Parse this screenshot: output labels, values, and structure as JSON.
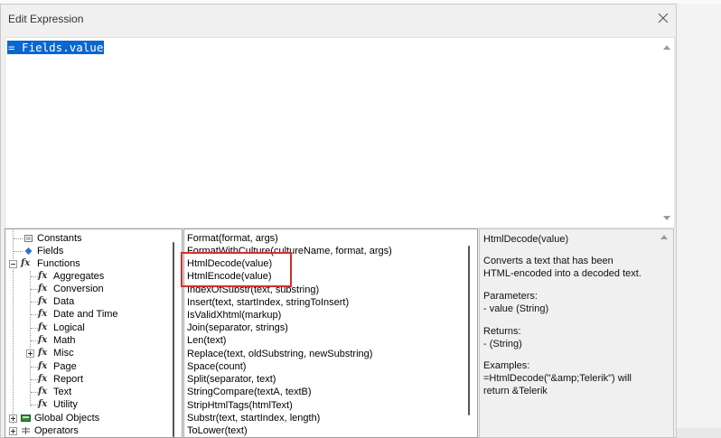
{
  "dialog": {
    "title": "Edit Expression"
  },
  "editor": {
    "expression": "= Fields.value"
  },
  "tree": {
    "items": [
      {
        "label": "Constants"
      },
      {
        "label": "Fields"
      },
      {
        "label": "Functions"
      },
      {
        "label": "Aggregates"
      },
      {
        "label": "Conversion"
      },
      {
        "label": "Data"
      },
      {
        "label": "Date and Time"
      },
      {
        "label": "Logical"
      },
      {
        "label": "Math"
      },
      {
        "label": "Misc"
      },
      {
        "label": "Page"
      },
      {
        "label": "Report"
      },
      {
        "label": "Text"
      },
      {
        "label": "Utility"
      },
      {
        "label": "Global Objects"
      },
      {
        "label": "Operators"
      }
    ],
    "fx_glyph": "fx"
  },
  "functions": {
    "items": [
      "Format(format, args)",
      "FormatWithCulture(cultureName, format, args)",
      "HtmlDecode(value)",
      "HtmlEncode(value)",
      "IndexOfSubstr(text, substring)",
      "Insert(text, startIndex, stringToInsert)",
      "IsValidXhtml(markup)",
      "Join(separator, strings)",
      "Len(text)",
      "Replace(text, oldSubstring, newSubstring)",
      "Space(count)",
      "Split(separator, text)",
      "StringCompare(textA, textB)",
      "StripHtmlTags(htmlText)",
      "Substr(text, startIndex, length)",
      "ToLower(text)"
    ]
  },
  "description": {
    "signature": "HtmlDecode(value)",
    "summary": "Converts a text that has been HTML-encoded into a decoded text.",
    "parameters_title": "Parameters:",
    "parameters": "- value (String)",
    "returns_title": "Returns:",
    "returns": "- (String)",
    "examples_title": "Examples:",
    "example": "=HtmlDecode(\"&amp;Telerik\") will return &Telerik"
  },
  "colors": {
    "selection": "#0a66d0",
    "highlight_box": "#d23030"
  }
}
